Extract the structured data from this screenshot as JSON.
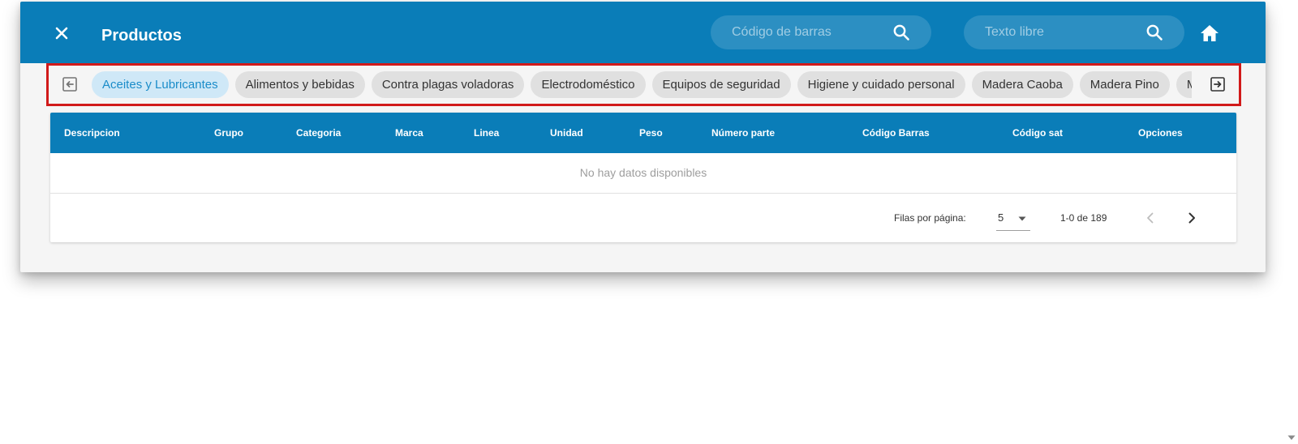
{
  "header": {
    "title": "Productos",
    "barcode_search_placeholder": "Código de barras",
    "text_search_placeholder": "Texto libre",
    "color": "#0a7db8"
  },
  "categories": {
    "items": [
      "Aceites y Lubricantes",
      "Alimentos y bebidas",
      "Contra plagas voladoras",
      "Electrodoméstico",
      "Equipos de seguridad",
      "Higiene y cuidado personal",
      "Madera Caoba",
      "Madera Pino",
      "Madera"
    ],
    "active_index": 0
  },
  "table": {
    "columns": [
      "Descripcion",
      "Grupo",
      "Categoria",
      "Marca",
      "Linea",
      "Unidad",
      "Peso",
      "Número parte",
      "Código Barras",
      "Código sat",
      "Opciones"
    ],
    "empty_message": "No hay datos disponibles"
  },
  "pagination": {
    "rows_per_page_label": "Filas por página:",
    "rows_per_page": "5",
    "range": "1-0 de 189"
  },
  "icons": {
    "close": "close-icon",
    "search": "search-icon",
    "home": "home-icon",
    "scroll_left": "arrow-left-box-icon",
    "scroll_right": "arrow-right-box-icon",
    "prev": "chevron-left-icon",
    "next": "chevron-right-icon",
    "dropdown": "caret-down-icon"
  }
}
